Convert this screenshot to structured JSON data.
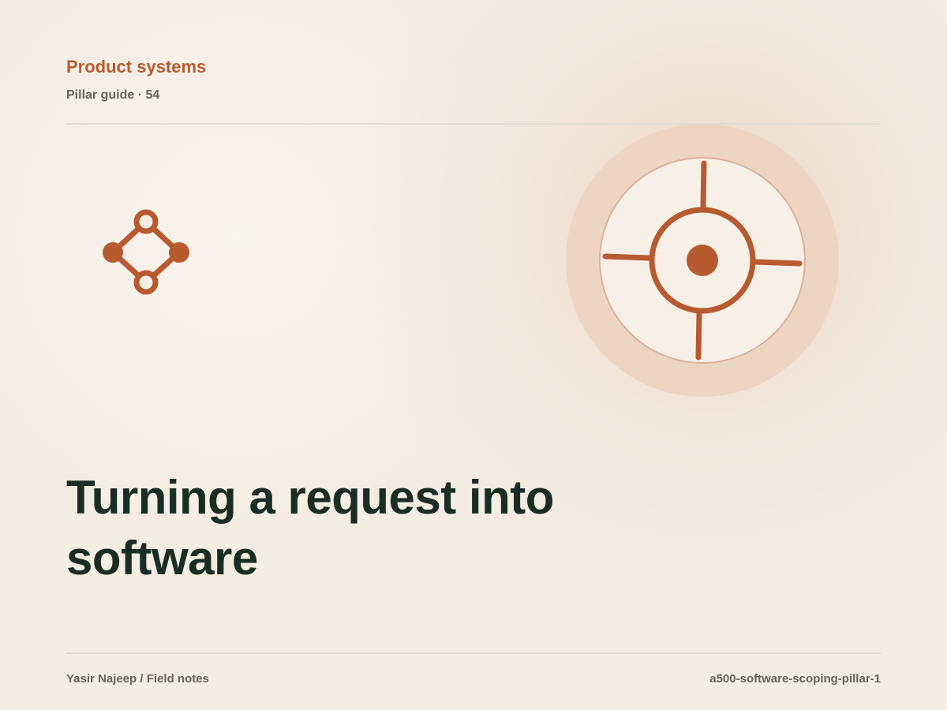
{
  "header": {
    "kicker": "Product systems",
    "subkicker": "Pillar guide · 54"
  },
  "title": "Turning a request into software",
  "footer": {
    "author": "Yasir Najeep / Field notes",
    "slug": "a500-software-scoping-pillar-1"
  },
  "icons": {
    "small": "network-diamond-icon",
    "large": "crosshair-target-icon"
  },
  "colors": {
    "accent": "#b85a30",
    "title": "#1a2d24",
    "muted": "#6a6259",
    "background": "#f4ede4",
    "halo": "#ecd2c1",
    "disc": "#f7f0e6"
  }
}
